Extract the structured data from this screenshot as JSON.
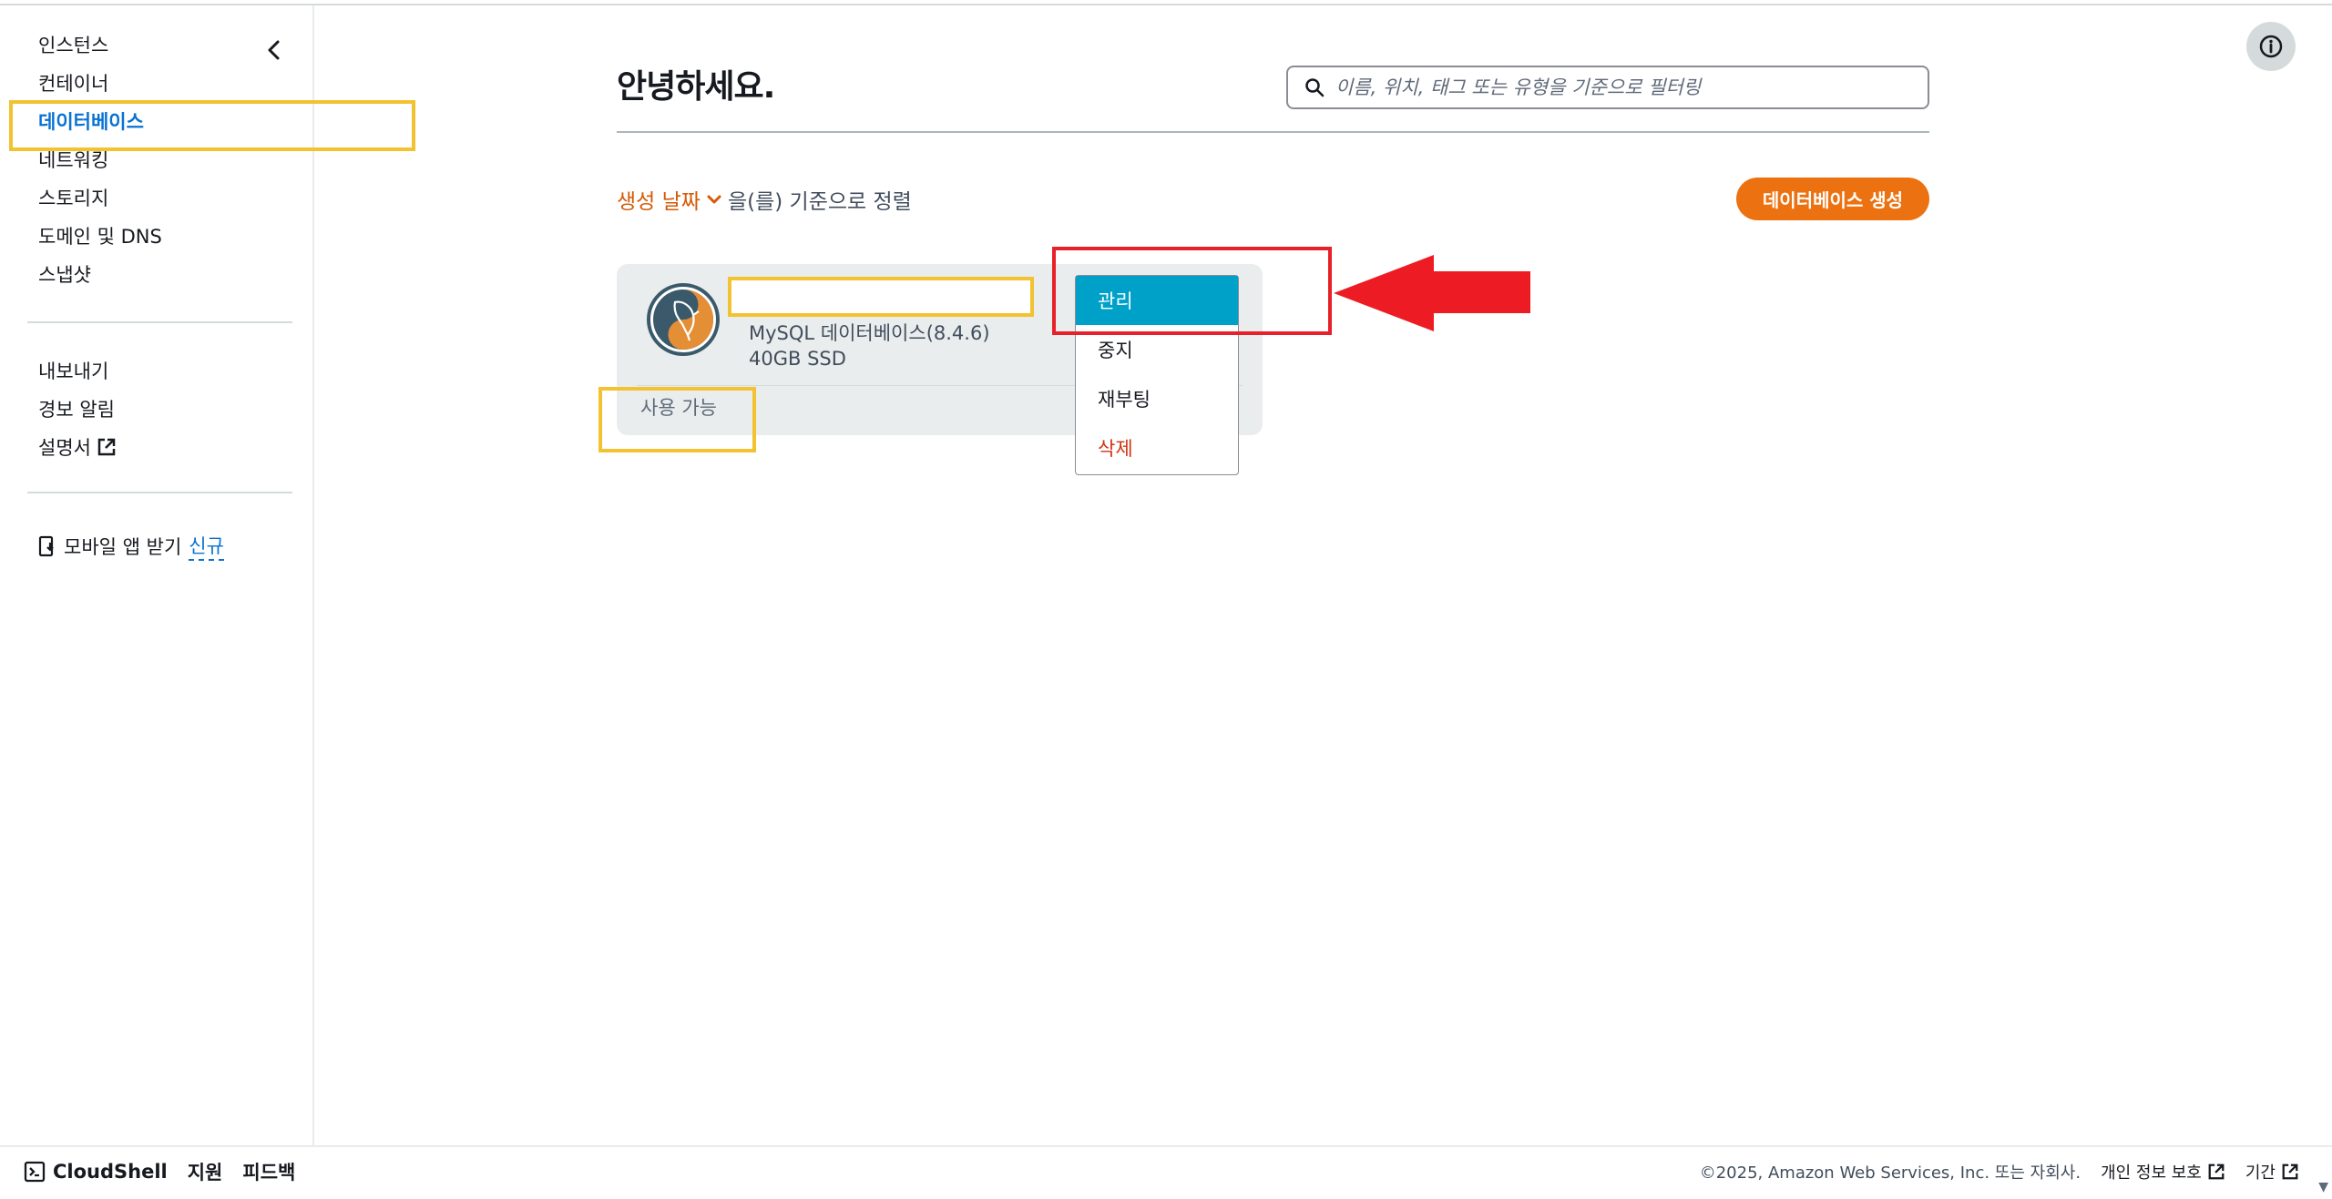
{
  "sidebar": {
    "items": [
      {
        "label": "인스턴스"
      },
      {
        "label": "컨테이너"
      },
      {
        "label": "데이터베이스"
      },
      {
        "label": "네트워킹"
      },
      {
        "label": "스토리지"
      },
      {
        "label": "도메인 및 DNS"
      },
      {
        "label": "스냅샷"
      }
    ],
    "secondary": [
      {
        "label": "내보내기"
      },
      {
        "label": "경보 알림"
      },
      {
        "label": "설명서"
      }
    ],
    "mobile_label": "모바일 앱 받기",
    "mobile_badge": "신규"
  },
  "main": {
    "title": "안녕하세요.",
    "search_placeholder": "이름, 위치, 태그 또는 유형을 기준으로 필터링",
    "sort_field": "생성 날짜",
    "sort_suffix": "을(를) 기준으로 정렬",
    "create_button": "데이터베이스 생성"
  },
  "database": {
    "name": "",
    "engine": "MySQL 데이터베이스(8.4.6)",
    "storage": "40GB SSD",
    "status": "사용 가능"
  },
  "menu": {
    "items": [
      {
        "label": "관리"
      },
      {
        "label": "중지"
      },
      {
        "label": "재부팅"
      },
      {
        "label": "삭제"
      }
    ]
  },
  "footer": {
    "cloudshell": "CloudShell",
    "support": "지원",
    "feedback": "피드백",
    "copyright": "©2025, Amazon Web Services, Inc. 또는 자회사.",
    "privacy": "개인 정보 보호",
    "terms": "기간"
  },
  "colors": {
    "accent_orange": "#ec7211",
    "sort_orange": "#d45b07",
    "active_blue": "#0972d3",
    "menu_selected": "#00a1c9",
    "danger": "#d13212",
    "highlight_yellow": "#f2c230",
    "highlight_red": "#e8202a"
  }
}
